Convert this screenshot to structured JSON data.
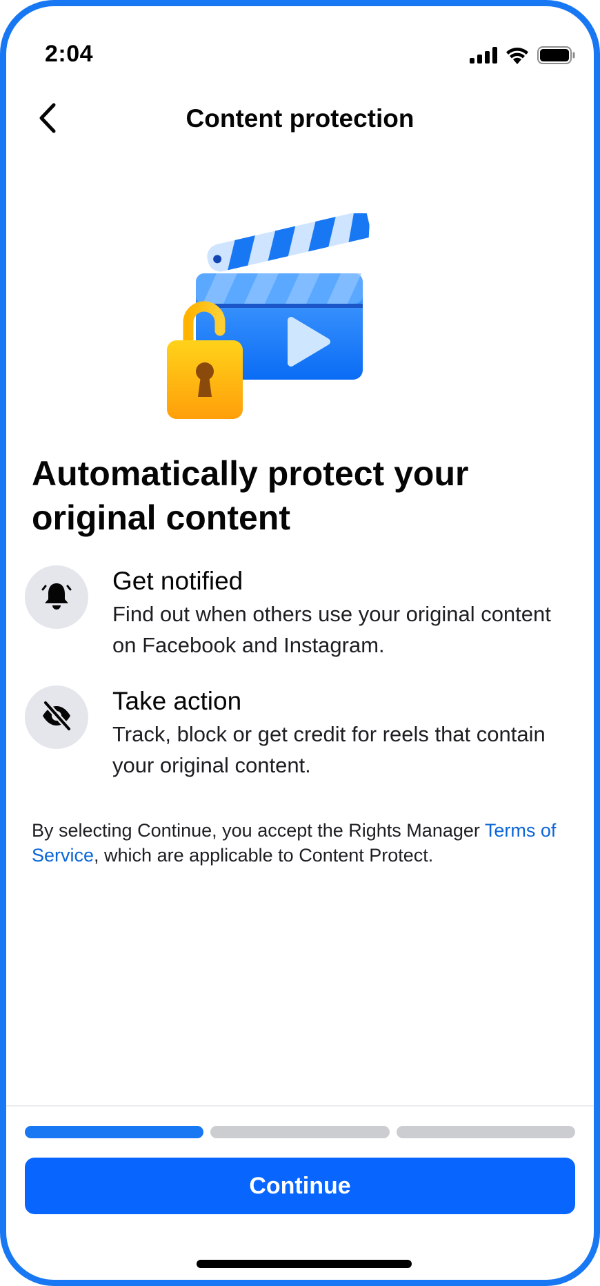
{
  "status_bar": {
    "time": "2:04",
    "icons": [
      "cellular-signal-icon",
      "wifi-icon",
      "battery-icon"
    ]
  },
  "nav": {
    "back_icon": "chevron-left-icon",
    "title": "Content protection"
  },
  "hero": {
    "icons": [
      "clapperboard-icon",
      "padlock-icon",
      "play-icon"
    ]
  },
  "headline": "Automatically protect your original content",
  "features": [
    {
      "icon": "bell-icon",
      "title": "Get notified",
      "description": "Find out when others use your original content on Facebook and Instagram."
    },
    {
      "icon": "eye-slash-icon",
      "title": "Take action",
      "description": "Track, block or get credit for reels that contain your original content."
    }
  ],
  "legal": {
    "before_link": "By selecting Continue, you accept the Rights Manager ",
    "link_text": "Terms of Service",
    "after_link": ", which are applicable to Content Protect."
  },
  "progress": {
    "total_steps": 3,
    "current_step": 1
  },
  "continue_label": "Continue",
  "colors": {
    "accent": "#1877f2",
    "button": "#0866ff",
    "link": "#0a66d8",
    "icon_bg": "#e4e6eb",
    "progress_inactive": "#cbcdd1"
  }
}
